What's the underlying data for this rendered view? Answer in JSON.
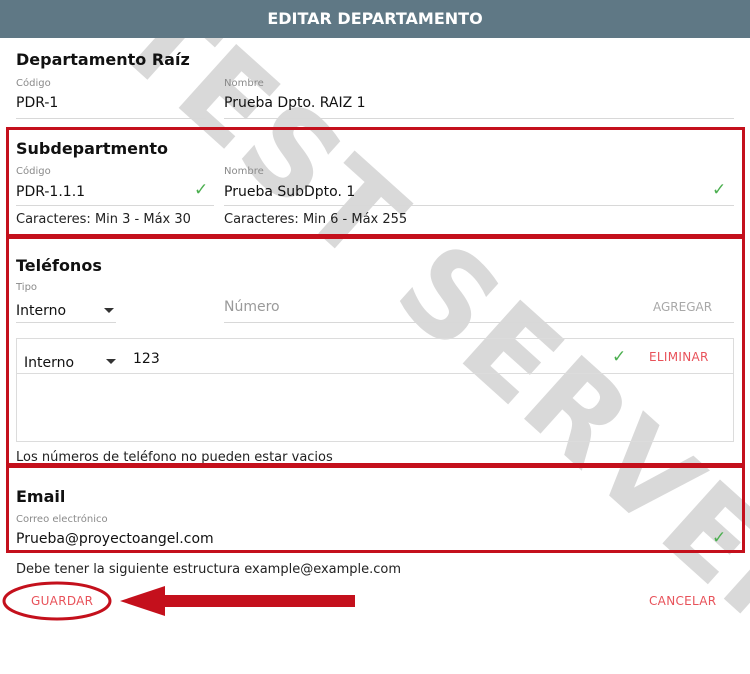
{
  "dialog": {
    "title": "EDITAR DEPARTAMENTO"
  },
  "watermark": "TEST SERVER",
  "root": {
    "title": "Departamento Raíz",
    "codigo_label": "Código",
    "codigo_value": "PDR-1",
    "nombre_label": "Nombre",
    "nombre_value": "Prueba Dpto. RAIZ 1"
  },
  "sub": {
    "title": "Subdepartmento",
    "codigo_label": "Código",
    "codigo_value": "PDR-1.1.1",
    "codigo_helper": "Caracteres: Min 3 - Máx 30",
    "nombre_label": "Nombre",
    "nombre_value": "Prueba SubDpto. 1",
    "nombre_helper": "Caracteres: Min 6 - Máx 255"
  },
  "phones": {
    "title": "Teléfonos",
    "tipo_label": "Tipo",
    "tipo_value": "Interno",
    "numero_placeholder": "Número",
    "add_label": "AGREGAR",
    "row": {
      "tipo": "Interno",
      "numero": "123",
      "delete_label": "ELIMINAR"
    },
    "helper": "Los números de teléfono no pueden estar vacios"
  },
  "email": {
    "title": "Email",
    "label": "Correo electrónico",
    "value": "Prueba@proyectoangel.com",
    "helper": "Debe tener la siguiente estructura example@example.com"
  },
  "actions": {
    "save_label": "GUARDAR",
    "cancel_label": "CANCELAR"
  },
  "icons": {
    "check": "check-icon",
    "caret": "chevron-down-icon",
    "arrow": "arrow-left-icon"
  },
  "colors": {
    "header": "#5f7885",
    "accent_red": "#c4101c",
    "action": "#e8525a",
    "valid": "#4caf50"
  }
}
